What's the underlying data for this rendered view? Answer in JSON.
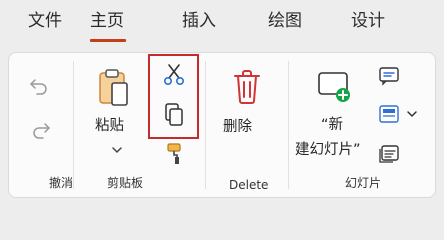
{
  "tabs": [
    {
      "label": "文件"
    },
    {
      "label": "主页"
    },
    {
      "label": "插入"
    },
    {
      "label": "绘图"
    },
    {
      "label": "设计"
    }
  ],
  "groups": {
    "undo": {
      "label": "撤消"
    },
    "clipboard": {
      "label": "剪贴板",
      "paste_label": "粘贴"
    },
    "delete": {
      "label": "Delete",
      "delete_label": "删除"
    },
    "slides": {
      "label": "幻灯片",
      "new_slide_line1": "“新",
      "new_slide_line2": "建幻灯片”"
    }
  },
  "colors": {
    "accent": "#c43e1c",
    "highlight": "#c42b2b",
    "delete_icon": "#d13438",
    "new_slide_plus": "#16a34a",
    "format_painter": "#e8a83a",
    "paste_clipboard": "#f0b870"
  },
  "icons": {
    "undo": "undo-icon",
    "redo": "redo-icon",
    "paste": "paste-icon",
    "cut": "scissors-icon",
    "copy": "copy-icon",
    "format_painter": "format-painter-icon",
    "delete": "trash-icon",
    "new_slide": "new-slide-icon",
    "layout": "layout-icon",
    "reset": "reset-icon",
    "section": "section-icon"
  }
}
